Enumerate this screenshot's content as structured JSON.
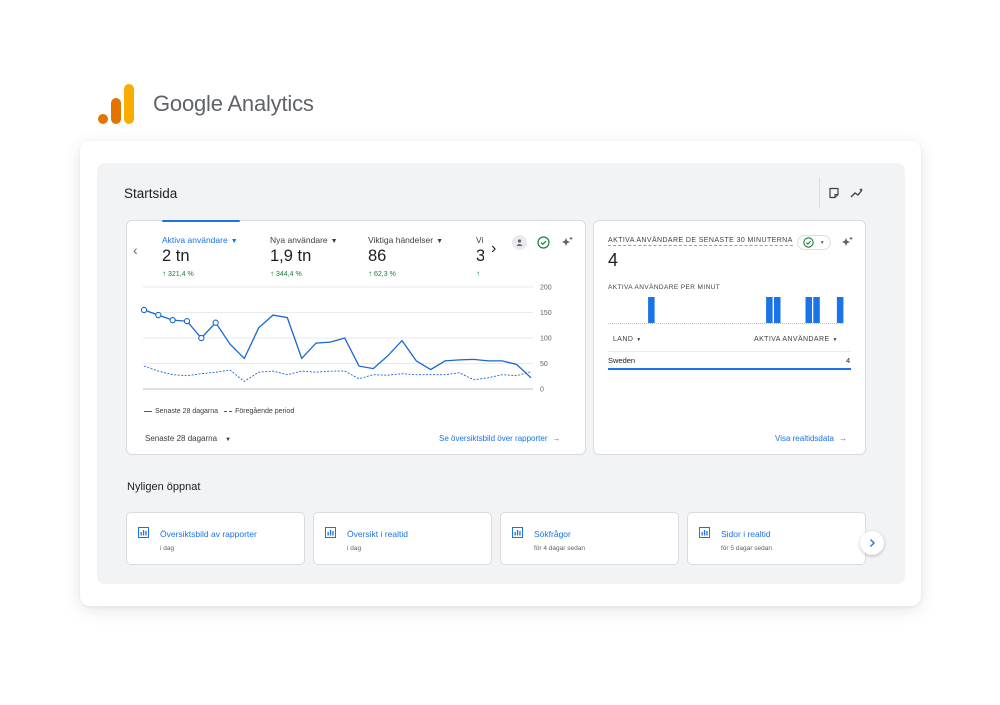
{
  "brand": {
    "name": "Google Analytics"
  },
  "page": {
    "title": "Startsida"
  },
  "overview_card": {
    "metrics": [
      {
        "label": "Aktiva användare",
        "value": "2 tn",
        "change": "321,4 %",
        "active": true
      },
      {
        "label": "Nya användare",
        "value": "1,9 tn",
        "change": "344,4 %"
      },
      {
        "label": "Viktiga händelser",
        "value": "86",
        "change": "62,3 %"
      },
      {
        "label": "Vi",
        "value": "3",
        "change": ""
      }
    ],
    "legend": {
      "current": "Senaste 28 dagarna",
      "previous": "Föregående period"
    },
    "date_range": "Senaste 28 dagarna",
    "link": "Se översiktsbild över rapporter"
  },
  "chart_data": {
    "type": "line",
    "y_ticks": [
      "200",
      "150",
      "100",
      "50",
      "0"
    ],
    "ylim": [
      0,
      200
    ],
    "grid": true,
    "series": [
      {
        "name": "Senaste 28 dagarna",
        "style": "solid",
        "values": [
          155,
          145,
          135,
          133,
          100,
          130,
          88,
          60,
          120,
          145,
          140,
          60,
          90,
          92,
          100,
          45,
          40,
          65,
          95,
          55,
          38,
          55,
          57,
          58,
          55,
          55,
          48,
          22
        ]
      },
      {
        "name": "Föregående period",
        "style": "dashed",
        "values": [
          45,
          35,
          28,
          26,
          30,
          33,
          37,
          15,
          33,
          35,
          28,
          35,
          33,
          35,
          35,
          20,
          28,
          27,
          30,
          28,
          28,
          28,
          32,
          18,
          22,
          28,
          26,
          34
        ]
      }
    ],
    "markers_first_n": 6
  },
  "realtime_card": {
    "title": "AKTIVA ANVÄNDARE DE SENASTE 30 MINUTERNA",
    "value": "4",
    "subtitle": "AKTIVA ANVÄNDARE PER MINUT",
    "per_minute": [
      0,
      0,
      0,
      0,
      0,
      1,
      0,
      0,
      0,
      0,
      0,
      0,
      0,
      0,
      0,
      0,
      0,
      0,
      0,
      0,
      1,
      1,
      0,
      0,
      0,
      1,
      1,
      0,
      0,
      1
    ],
    "col_country": "LAND",
    "col_users": "AKTIVA ANVÄNDARE",
    "rows": [
      {
        "country": "Sweden",
        "users": "4",
        "share": 1.0
      }
    ],
    "link": "Visa realtidsdata"
  },
  "recent": {
    "title": "Nyligen öppnat",
    "items": [
      {
        "title": "Översiktsbild av rapporter",
        "time": "i dag"
      },
      {
        "title": "Översikt i realtid",
        "time": "i dag"
      },
      {
        "title": "Sökfrågor",
        "time": "för 4 dagar sedan"
      },
      {
        "title": "Sidor i realtid",
        "time": "för 5 dagar sedan"
      }
    ]
  },
  "colors": {
    "accent": "#1a73e8",
    "line": "#1967d2",
    "positive": "#188038",
    "logo_orange": "#f9ab00",
    "logo_dark": "#e37400"
  }
}
